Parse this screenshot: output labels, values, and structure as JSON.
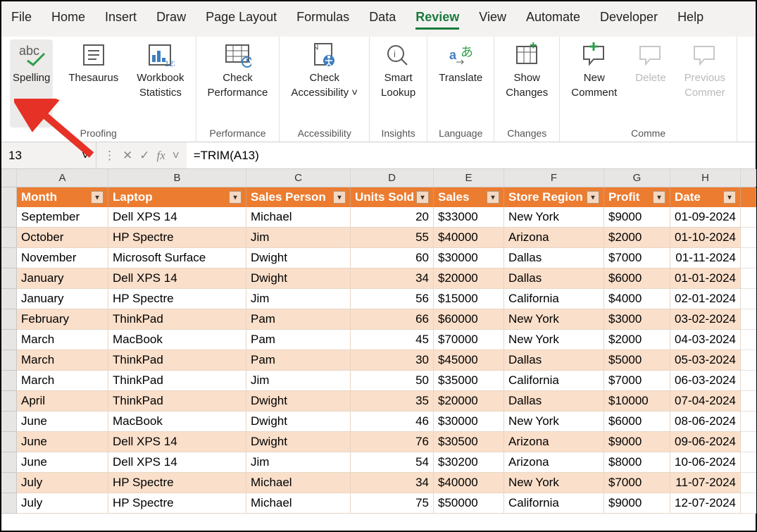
{
  "menubar": [
    "File",
    "Home",
    "Insert",
    "Draw",
    "Page Layout",
    "Formulas",
    "Data",
    "Review",
    "View",
    "Automate",
    "Developer",
    "Help"
  ],
  "menubar_active": "Review",
  "ribbon": {
    "groups": [
      {
        "label": "Proofing",
        "buttons": [
          {
            "name": "spelling-button",
            "label": "Spelling",
            "icon": "abc-check",
            "sel": true
          },
          {
            "name": "thesaurus-button",
            "label": "Thesaurus",
            "icon": "thesaurus"
          },
          {
            "name": "workbook-stats-button",
            "label": "Workbook\nStatistics",
            "icon": "wb-stats"
          }
        ]
      },
      {
        "label": "Performance",
        "buttons": [
          {
            "name": "check-performance-button",
            "label": "Check\nPerformance",
            "icon": "perf"
          }
        ]
      },
      {
        "label": "Accessibility",
        "buttons": [
          {
            "name": "check-accessibility-button",
            "label": "Check\nAccessibility ˅",
            "icon": "access"
          }
        ]
      },
      {
        "label": "Insights",
        "buttons": [
          {
            "name": "smart-lookup-button",
            "label": "Smart\nLookup",
            "icon": "lookup"
          }
        ]
      },
      {
        "label": "Language",
        "buttons": [
          {
            "name": "translate-button",
            "label": "Translate",
            "icon": "translate"
          }
        ]
      },
      {
        "label": "Changes",
        "buttons": [
          {
            "name": "show-changes-button",
            "label": "Show\nChanges",
            "icon": "changes"
          }
        ]
      },
      {
        "label": "Comme",
        "buttons": [
          {
            "name": "new-comment-button",
            "label": "New\nComment",
            "icon": "comment-new"
          },
          {
            "name": "delete-comment-button",
            "label": "Delete",
            "icon": "comment",
            "dim": true
          },
          {
            "name": "previous-comment-button",
            "label": "Previous\nCommer",
            "icon": "comment",
            "dim": true
          }
        ]
      }
    ]
  },
  "namebox": "13",
  "formula": "=TRIM(A13)",
  "columns": [
    "",
    "A",
    "B",
    "C",
    "D",
    "E",
    "F",
    "G",
    "H",
    ""
  ],
  "table_headers": [
    "Month",
    "Laptop",
    "Sales Person",
    "Units Sold",
    "Sales",
    "Store Region",
    "Profit",
    "Date"
  ],
  "chart_data": {
    "type": "table",
    "columns": [
      "Month",
      "Laptop",
      "Sales Person",
      "Units Sold",
      "Sales",
      "Store Region",
      "Profit",
      "Date"
    ],
    "rows": [
      [
        "September",
        "Dell XPS 14",
        "Michael",
        20,
        "$33000",
        "New York",
        "$9000",
        "01-09-2024"
      ],
      [
        "October",
        "HP Spectre",
        "Jim",
        55,
        "$40000",
        "Arizona",
        "$2000",
        "01-10-2024"
      ],
      [
        "November",
        "Microsoft Surface",
        "Dwight",
        60,
        "$30000",
        "Dallas",
        "$7000",
        "01-11-2024"
      ],
      [
        "January",
        "Dell XPS 14",
        "Dwight",
        34,
        "$20000",
        "Dallas",
        "$6000",
        "01-01-2024"
      ],
      [
        "January",
        "HP Spectre",
        "Jim",
        56,
        "$15000",
        "California",
        "$4000",
        "02-01-2024"
      ],
      [
        "February",
        "ThinkPad",
        "Pam",
        66,
        "$60000",
        "New York",
        "$3000",
        "03-02-2024"
      ],
      [
        "March",
        "MacBook",
        "Pam",
        45,
        "$70000",
        "New York",
        "$2000",
        "04-03-2024"
      ],
      [
        "March",
        "ThinkPad",
        "Pam",
        30,
        "$45000",
        "Dallas",
        "$5000",
        "05-03-2024"
      ],
      [
        "March",
        "ThinkPad",
        "Jim",
        50,
        "$35000",
        "California",
        "$7000",
        "06-03-2024"
      ],
      [
        "April",
        "ThinkPad",
        "Dwight",
        35,
        "$20000",
        "Dallas",
        "$10000",
        "07-04-2024"
      ],
      [
        "June",
        "MacBook",
        "Dwight",
        46,
        "$30000",
        "New York",
        "$6000",
        "08-06-2024"
      ],
      [
        "June",
        "Dell XPS 14",
        "Dwight",
        76,
        "$30500",
        "Arizona",
        "$9000",
        "09-06-2024"
      ],
      [
        "June",
        "Dell XPS 14",
        "Jim",
        54,
        "$30200",
        "Arizona",
        "$8000",
        "10-06-2024"
      ],
      [
        "July",
        "HP Spectre",
        "Michael",
        34,
        "$40000",
        "New York",
        "$7000",
        "11-07-2024"
      ],
      [
        "July",
        "HP Spectre",
        "Michael",
        75,
        "$50000",
        "California",
        "$9000",
        "12-07-2024"
      ]
    ]
  }
}
